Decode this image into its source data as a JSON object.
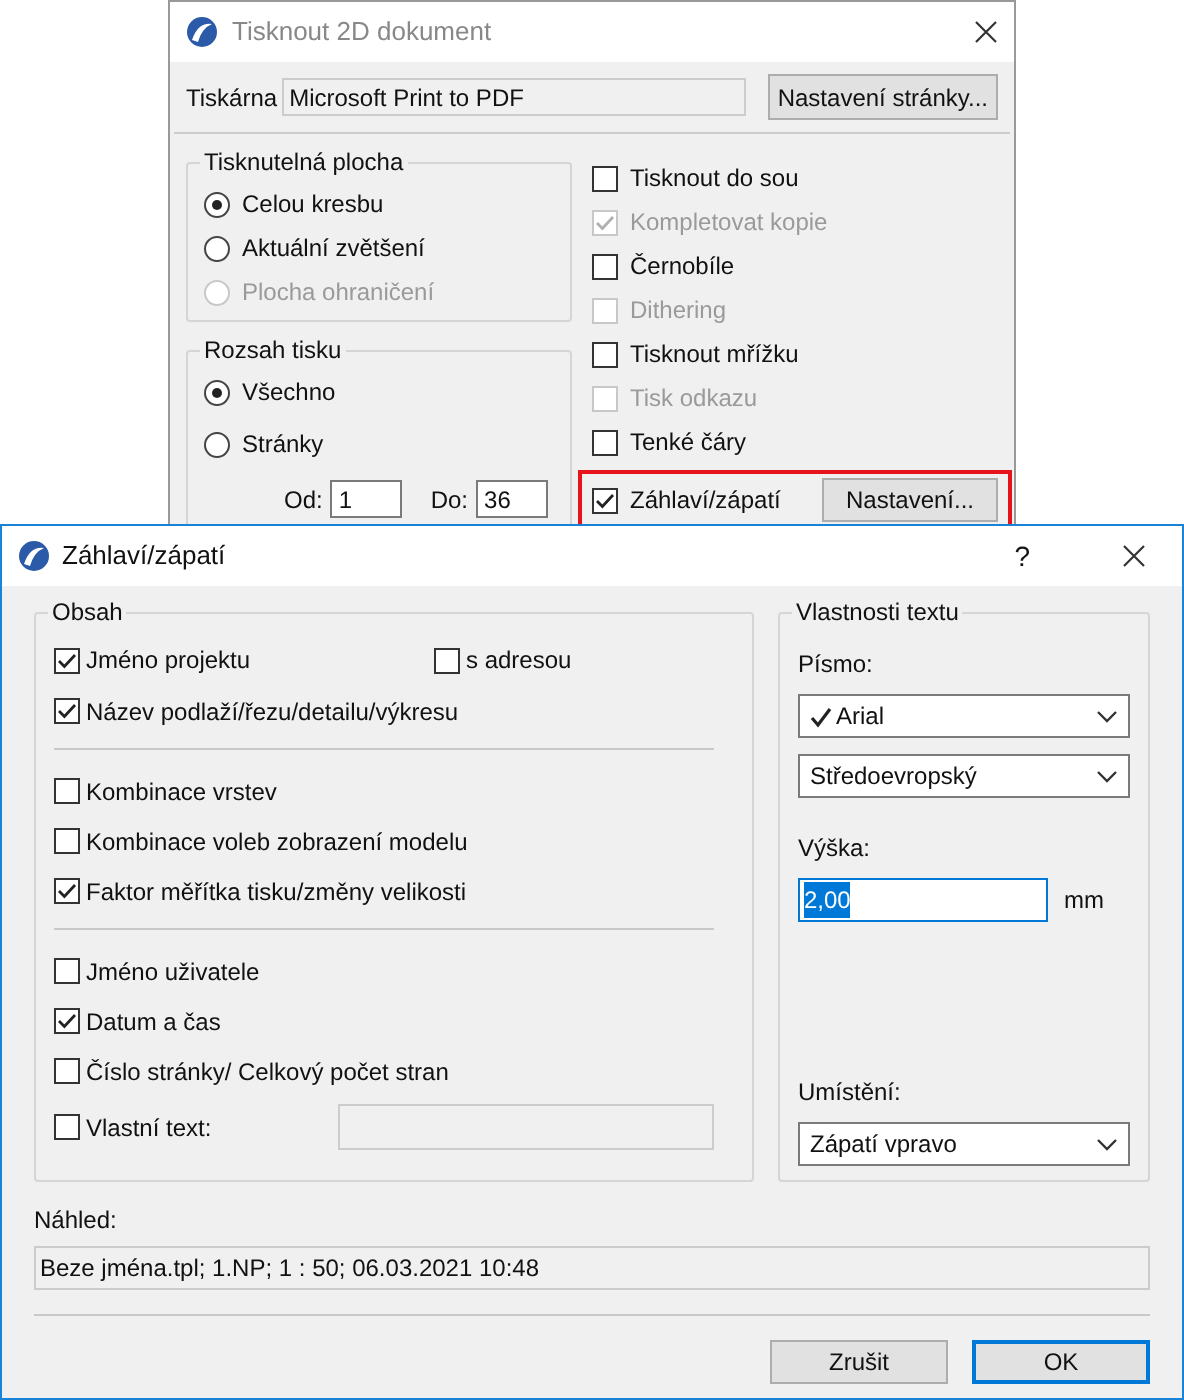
{
  "print_window": {
    "title": "Tisknout 2D dokument",
    "printer_label": "Tiskárna",
    "printer_value": "Microsoft Print to PDF",
    "page_setup_button": "Nastavení stránky...",
    "printable_area": {
      "title": "Tisknutelná plocha",
      "options": [
        {
          "label": "Celou kresbu",
          "selected": true,
          "disabled": false
        },
        {
          "label": "Aktuální zvětšení",
          "selected": false,
          "disabled": false
        },
        {
          "label": "Plocha ohraničení",
          "selected": false,
          "disabled": true
        }
      ]
    },
    "print_range": {
      "title": "Rozsah tisku",
      "options": [
        {
          "label": "Všechno",
          "selected": true
        },
        {
          "label": "Stránky",
          "selected": false
        }
      ],
      "from_label": "Od:",
      "from_value": "1",
      "to_label": "Do:",
      "to_value": "36"
    },
    "options": [
      {
        "label": "Tisknout do sou",
        "checked": false,
        "disabled": false,
        "highlighted": false
      },
      {
        "label": "Kompletovat kopie",
        "checked": true,
        "disabled": true,
        "highlighted": false
      },
      {
        "label": "Černobíle",
        "checked": false,
        "disabled": false,
        "highlighted": false
      },
      {
        "label": "Dithering",
        "checked": false,
        "disabled": true,
        "highlighted": false
      },
      {
        "label": "Tisknout mřížku",
        "checked": false,
        "disabled": false,
        "highlighted": false
      },
      {
        "label": "Tisk odkazu",
        "checked": false,
        "disabled": true,
        "highlighted": false
      },
      {
        "label": "Tenké čáry",
        "checked": false,
        "disabled": false,
        "highlighted": false
      },
      {
        "label": "Záhlaví/zápatí",
        "checked": true,
        "disabled": false,
        "highlighted": true,
        "button": "Nastavení..."
      }
    ]
  },
  "header_footer_window": {
    "title": "Záhlaví/zápatí",
    "help": "?",
    "content": {
      "title": "Obsah",
      "sections": [
        [
          {
            "kind": "checkbox",
            "label": "Jméno projektu",
            "checked": true,
            "extra": {
              "label": "s adresou",
              "checked": false
            }
          },
          {
            "kind": "checkbox",
            "label": "Název podlaží/řezu/detailu/výkresu",
            "checked": true
          }
        ],
        [
          {
            "kind": "checkbox",
            "label": "Kombinace vrstev",
            "checked": false
          },
          {
            "kind": "checkbox",
            "label": "Kombinace voleb zobrazení modelu",
            "checked": false
          },
          {
            "kind": "checkbox",
            "label": "Faktor měřítka tisku/změny velikosti",
            "checked": true
          }
        ],
        [
          {
            "kind": "checkbox",
            "label": "Jméno uživatele",
            "checked": false
          },
          {
            "kind": "checkbox",
            "label": "Datum a čas",
            "checked": true
          },
          {
            "kind": "checkbox",
            "label": "Číslo stránky/ Celkový počet stran",
            "checked": false
          },
          {
            "kind": "checkbox_field",
            "label": "Vlastní text:",
            "checked": false
          }
        ]
      ]
    },
    "text_properties": {
      "title": "Vlastnosti textu",
      "font_label": "Písmo:",
      "font_value": "Arial",
      "charset_value": "Středoevropský",
      "height_label": "Výška:",
      "height_value": "2,00",
      "height_unit": "mm",
      "placement_label": "Umístění:",
      "placement_value": "Zápatí vpravo"
    },
    "preview_label": "Náhled:",
    "preview_value": "Beze jména.tpl; 1.NP; 1 : 50; 06.03.2021 10:48",
    "buttons": [
      {
        "label": "Zrušit",
        "default": false
      },
      {
        "label": "OK",
        "default": true
      }
    ]
  }
}
